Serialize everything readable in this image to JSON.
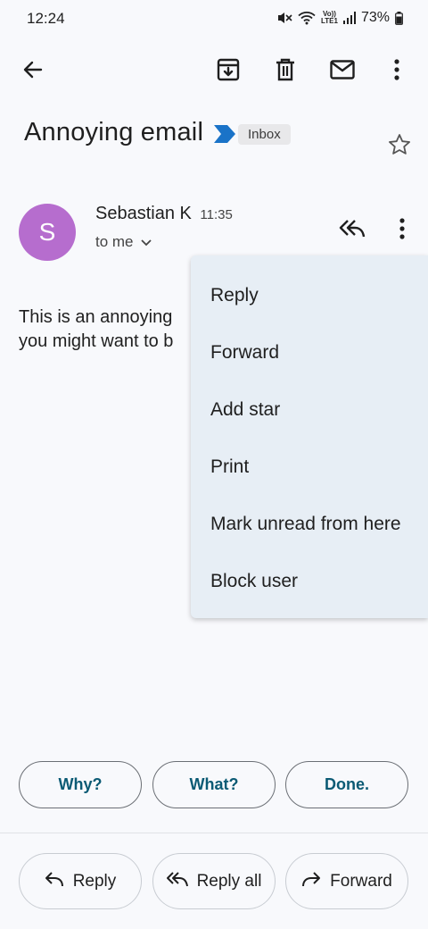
{
  "status_bar": {
    "time": "12:24",
    "battery": "73%",
    "volte_top": "Vo))",
    "volte_bottom": "LTE1"
  },
  "toolbar": {
    "icons": [
      "back-arrow-icon",
      "archive-icon",
      "delete-icon",
      "mark-unread-mail-icon",
      "more-vert-icon"
    ]
  },
  "email": {
    "subject": "Annoying email",
    "label": "Inbox",
    "sender_name": "Sebastian K",
    "time": "11:35",
    "recipient": "to me",
    "avatar_letter": "S",
    "avatar_color": "#b66dce",
    "body_line1": "This is an annoying",
    "body_line2": "you might want to b"
  },
  "menu": {
    "items": [
      "Reply",
      "Forward",
      "Add star",
      "Print",
      "Mark unread from here",
      "Block user"
    ]
  },
  "smart_replies": [
    "Why?",
    "What?",
    "Done."
  ],
  "actions": {
    "reply": "Reply",
    "reply_all": "Reply all",
    "forward": "Forward"
  },
  "colors": {
    "background": "#f8f9fc",
    "menu_background": "#e7eef5",
    "smart_reply_text": "#0b5a74",
    "label_arrow": "#1a73c8"
  }
}
